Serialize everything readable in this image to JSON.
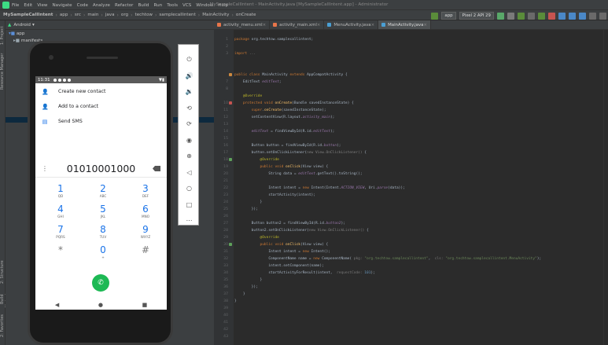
{
  "window": {
    "title": "MySampleCallIntent - MainActivity.java [MySampleCallIntent.app] - Administrator"
  },
  "menu": [
    "File",
    "Edit",
    "View",
    "Navigate",
    "Code",
    "Analyze",
    "Refactor",
    "Build",
    "Run",
    "Tools",
    "VCS",
    "Window",
    "Help"
  ],
  "breadcrumbs": [
    "MySampleCallIntent",
    "app",
    "src",
    "main",
    "java",
    "org",
    "techtow",
    "samplecallintent",
    "MainActivity",
    "onCreate"
  ],
  "toolbar": {
    "config": "app",
    "device": "Pixel 2 API 29"
  },
  "left_tool_windows": [
    "1: Project",
    "Resource Manager",
    "2: Structure",
    "Build Variants",
    "2: Favorites"
  ],
  "project": {
    "view": "Android",
    "root": "app",
    "child": "manifests"
  },
  "editor_tabs": [
    {
      "label": "activity_menu.xml",
      "color": "#e8754a"
    },
    {
      "label": "activity_main.xml",
      "color": "#e8754a"
    },
    {
      "label": "MenuActivity.java",
      "color": "#4a9fd4"
    },
    {
      "label": "MainActivity.java",
      "color": "#4a9fd4",
      "active": true
    }
  ],
  "gutter_lines": [
    "1",
    "2",
    "3",
    "",
    "",
    "",
    "7",
    "8",
    "",
    "10",
    "11",
    "12",
    "13",
    "14",
    "15",
    "16",
    "17",
    "18",
    "19",
    "20",
    "21",
    "22",
    "23",
    "24",
    "25",
    "26",
    "27",
    "28",
    "29",
    "30",
    "31",
    "32",
    "33",
    "34",
    "35",
    "36",
    "37",
    "38",
    "39",
    "40",
    "41",
    "42",
    "43"
  ],
  "code_lines": [
    [
      [
        "k",
        "package "
      ],
      [
        "",
        "org.techtow.samplecallintent;"
      ]
    ],
    [],
    [
      [
        "k",
        "import "
      ],
      [
        "c",
        "..."
      ]
    ],
    [],
    [],
    [
      [
        "k",
        "public class "
      ],
      [
        "",
        "MainActivity "
      ],
      [
        "k",
        "extends "
      ],
      [
        "",
        "AppCompatActivity {"
      ]
    ],
    [
      [
        "",
        "    EditText "
      ],
      [
        "f",
        "editText"
      ],
      [
        "",
        ";"
      ]
    ],
    [],
    [
      [
        "a",
        "    @Override"
      ]
    ],
    [
      [
        "k",
        "    protected void "
      ],
      [
        "m",
        "onCreate"
      ],
      [
        "",
        "(Bundle savedInstanceState) {"
      ]
    ],
    [
      [
        "k",
        "        super"
      ],
      [
        "",
        "."
      ],
      [
        "m",
        "onCreate"
      ],
      [
        "",
        "(savedInstanceState);"
      ]
    ],
    [
      [
        "",
        "        setContentView(R.layout."
      ],
      [
        "f",
        "activity_main"
      ],
      [
        "",
        ");"
      ]
    ],
    [],
    [
      [
        "",
        "        "
      ],
      [
        "f",
        "editText"
      ],
      [
        "",
        " = findViewById(R.id."
      ],
      [
        "f",
        "editText"
      ],
      [
        "",
        ");"
      ]
    ],
    [],
    [
      [
        "",
        "        Button button = findViewById(R.id."
      ],
      [
        "f",
        "button"
      ],
      [
        "",
        ");"
      ]
    ],
    [
      [
        "",
        "        button.setOnClickListener("
      ],
      [
        "c",
        "new View.OnClickListener() "
      ],
      [
        "",
        "{"
      ]
    ],
    [
      [
        "a",
        "            @Override"
      ]
    ],
    [
      [
        "k",
        "            public void "
      ],
      [
        "m",
        "onClick"
      ],
      [
        "",
        "(View view) {"
      ]
    ],
    [
      [
        "",
        "                String data = "
      ],
      [
        "f",
        "editText"
      ],
      [
        "",
        ".getText().toString();"
      ]
    ],
    [],
    [
      [
        "",
        "                Intent intent = "
      ],
      [
        "k",
        "new "
      ],
      [
        "",
        "Intent(Intent."
      ],
      [
        "f",
        "ACTION_VIEW"
      ],
      [
        "",
        ", Uri."
      ],
      [
        "f",
        "parse"
      ],
      [
        "",
        "(data));"
      ]
    ],
    [
      [
        "",
        "                startActivity(intent);"
      ]
    ],
    [
      [
        "",
        "            }"
      ]
    ],
    [
      [
        "",
        "        });"
      ]
    ],
    [],
    [
      [
        "",
        "        Button button2 = findViewById(R.id."
      ],
      [
        "f",
        "button2"
      ],
      [
        "",
        ");"
      ]
    ],
    [
      [
        "",
        "        button2.setOnClickListener("
      ],
      [
        "c",
        "new View.OnClickListener() "
      ],
      [
        "",
        "{"
      ]
    ],
    [
      [
        "a",
        "            @Override"
      ]
    ],
    [
      [
        "k",
        "            public void "
      ],
      [
        "m",
        "onClick"
      ],
      [
        "",
        "(View view) {"
      ]
    ],
    [
      [
        "",
        "                Intent intent = "
      ],
      [
        "k",
        "new "
      ],
      [
        "",
        "Intent();"
      ]
    ],
    [
      [
        "",
        "                ComponentName name = "
      ],
      [
        "k",
        "new "
      ],
      [
        "",
        "ComponentName( "
      ],
      [
        "h",
        "pkg: "
      ],
      [
        "s",
        "\"org.techtow.samplecallintent\""
      ],
      [
        "",
        ",  "
      ],
      [
        "h",
        "cls: "
      ],
      [
        "s",
        "\"org.techtow.samplecallintent.MenuActivity\""
      ],
      [
        "",
        ");"
      ]
    ],
    [
      [
        "",
        "                intent.setComponent(name);"
      ]
    ],
    [
      [
        "",
        "                startActivityForResult(intent,  "
      ],
      [
        "h",
        "requestCode: "
      ],
      [
        "n",
        "101"
      ],
      [
        "",
        ");"
      ]
    ],
    [
      [
        "",
        "            }"
      ]
    ],
    [
      [
        "",
        "        });"
      ]
    ],
    [
      [
        "",
        "    }"
      ]
    ],
    [
      [
        "",
        "}"
      ]
    ]
  ],
  "phone": {
    "time": "11:31",
    "menu_items": [
      {
        "label": "Create new contact",
        "icon": "add-person-icon"
      },
      {
        "label": "Add to a contact",
        "icon": "person-icon"
      },
      {
        "label": "Send SMS",
        "icon": "message-icon"
      }
    ],
    "number": "01010001000",
    "keys": [
      {
        "digit": "1",
        "letters": "QD"
      },
      {
        "digit": "2",
        "letters": "ABC"
      },
      {
        "digit": "3",
        "letters": "DEF"
      },
      {
        "digit": "4",
        "letters": "GHI"
      },
      {
        "digit": "5",
        "letters": "JKL"
      },
      {
        "digit": "6",
        "letters": "MNO"
      },
      {
        "digit": "7",
        "letters": "PQRS"
      },
      {
        "digit": "8",
        "letters": "TUV"
      },
      {
        "digit": "9",
        "letters": "WXYZ"
      },
      {
        "digit": "*",
        "letters": ""
      },
      {
        "digit": "0",
        "letters": "+"
      },
      {
        "digit": "#",
        "letters": ""
      }
    ]
  },
  "emulator_tools": [
    "power-icon",
    "volume-up-icon",
    "volume-down-icon",
    "rotate-left-icon",
    "rotate-right-icon",
    "camera-icon",
    "zoom-in-icon",
    "back-icon",
    "home-icon",
    "overview-icon",
    "more-icon"
  ]
}
